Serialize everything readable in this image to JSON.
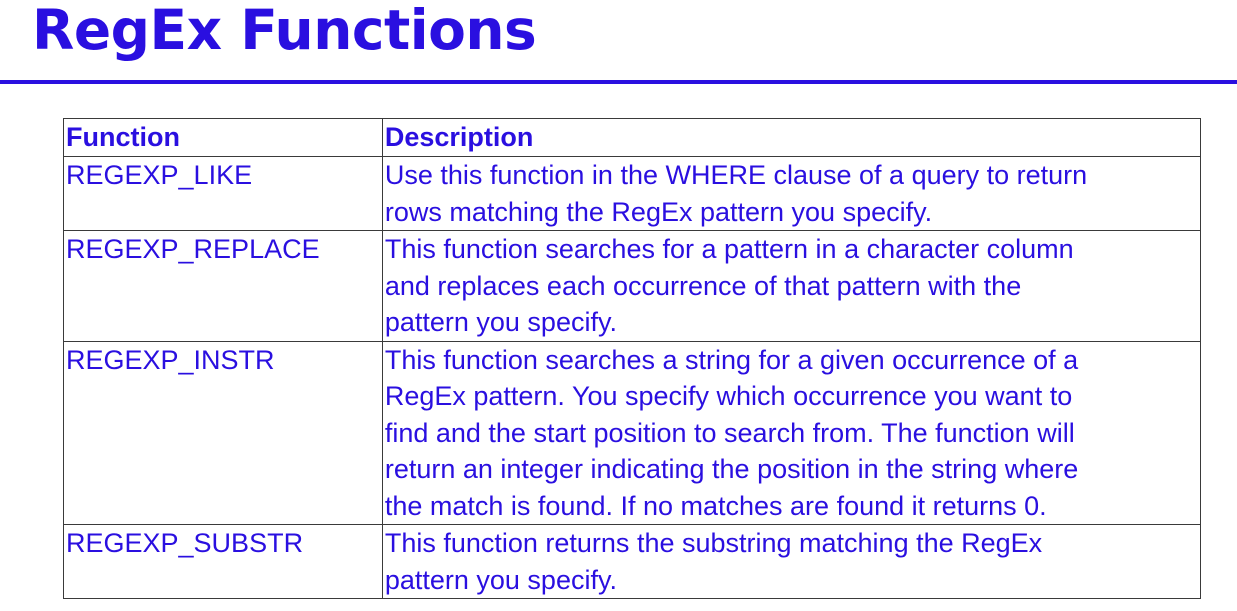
{
  "slide": {
    "title": "RegEx Functions",
    "accent_color": "#2a0fe0"
  },
  "table": {
    "headers": {
      "function": "Function",
      "description": "Description"
    },
    "rows": [
      {
        "function": "REGEXP_LIKE",
        "description": "Use this function in the WHERE clause of a query to return\nrows matching the RegEx pattern you specify."
      },
      {
        "function": "REGEXP_REPLACE",
        "description": "This function searches for a pattern in a character column\nand replaces each occurrence of that pattern with the\npattern you specify."
      },
      {
        "function": "REGEXP_INSTR",
        "description": "This function searches a string for a given occurrence of a\nRegEx pattern. You specify which occurrence you want to\nfind and the start position to search from. The function will\nreturn an integer indicating the position in the string where\nthe match is found. If no matches are found it returns 0."
      },
      {
        "function": "REGEXP_SUBSTR",
        "description": "This function returns the substring matching the RegEx\npattern you specify."
      }
    ]
  }
}
